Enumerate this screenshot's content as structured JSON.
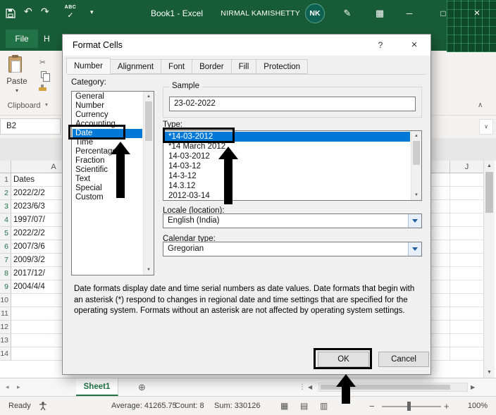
{
  "titlebar": {
    "title": "Book1 - Excel",
    "user_name": "NIRMAL KAMISHETTY",
    "avatar_initials": "NK"
  },
  "ribbon": {
    "file_tab": "File",
    "home_tab_partial": "H",
    "paste_label": "Paste",
    "clipboard_group_label": "Clipboard"
  },
  "formula_bar": {
    "name_box": "B2"
  },
  "sheet": {
    "column_headers": {
      "a": "A",
      "j": "J"
    },
    "rows": [
      {
        "n": "1",
        "a": "Dates"
      },
      {
        "n": "2",
        "a": "2022/2/2"
      },
      {
        "n": "3",
        "a": "2023/6/3"
      },
      {
        "n": "4",
        "a": "1997/07/"
      },
      {
        "n": "5",
        "a": "2022/2/2"
      },
      {
        "n": "6",
        "a": "2007/3/6"
      },
      {
        "n": "7",
        "a": "2009/3/2"
      },
      {
        "n": "8",
        "a": "2017/12/"
      },
      {
        "n": "9",
        "a": "2004/4/4"
      },
      {
        "n": "10",
        "a": ""
      },
      {
        "n": "11",
        "a": ""
      },
      {
        "n": "12",
        "a": ""
      },
      {
        "n": "13",
        "a": ""
      },
      {
        "n": "14",
        "a": ""
      }
    ],
    "sheet_tab": "Sheet1"
  },
  "status_bar": {
    "mode": "Ready",
    "average": "Average: 41265.75",
    "count": "Count: 8",
    "sum": "Sum: 330126",
    "zoom_level": "100%"
  },
  "dialog": {
    "title": "Format Cells",
    "tabs": [
      "Number",
      "Alignment",
      "Font",
      "Border",
      "Fill",
      "Protection"
    ],
    "active_tab": "Number",
    "category_label": "Category:",
    "categories": [
      "General",
      "Number",
      "Currency",
      "Accounting",
      "Date",
      "Time",
      "Percentage",
      "Fraction",
      "Scientific",
      "Text",
      "Special",
      "Custom"
    ],
    "selected_category": "Date",
    "sample_group_label": "Sample",
    "sample_value": "23-02-2022",
    "type_label": "Type:",
    "types": [
      "*14-03-2012",
      "*14 March 2012",
      "14-03-2012",
      "14-03-12",
      "14-3-12",
      "14.3.12",
      "2012-03-14"
    ],
    "selected_type": "*14-03-2012",
    "locale_label": "Locale (location):",
    "locale_value": "English (India)",
    "calendar_label": "Calendar type:",
    "calendar_value": "Gregorian",
    "description": "Date formats display date and time serial numbers as date values.  Date formats that begin with an asterisk (*) respond to changes in regional date and time settings that are specified for the operating system. Formats without an asterisk are not affected by operating system settings.",
    "ok_label": "OK",
    "cancel_label": "Cancel"
  },
  "colors": {
    "title_bar_green": "#185c37",
    "excel_green": "#217346",
    "selection_blue": "#0078d7",
    "annotation_black": "#000000"
  },
  "icons": {
    "undo": "↶",
    "redo": "↷",
    "qat_dropdown": "▾",
    "spell_abc": "ABC",
    "spell_check": "✓",
    "pen": "✎",
    "grid": "▦",
    "minimize": "─",
    "maximize": "□",
    "close": "×",
    "dialog_help": "?",
    "dialog_close": "×",
    "collapse_ribbon": "∧",
    "formula_expand": "∨",
    "scissors": "✂",
    "launcher": "▾",
    "scroll_up": "▲",
    "scroll_down": "▼",
    "scroll_left": "◀",
    "scroll_right": "▶",
    "sheet_nav_left": "◂",
    "sheet_nav_right": "▸",
    "add_sheet": "⊕",
    "tab_splitter": "⋮",
    "zoom_out": "−",
    "zoom_in": "+",
    "view_normal": "▦",
    "view_layout": "▤",
    "view_break": "▥"
  }
}
